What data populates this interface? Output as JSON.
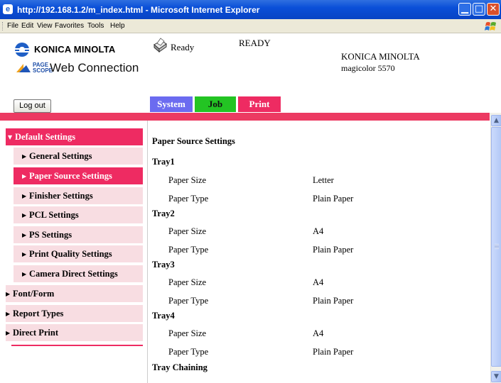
{
  "window": {
    "title": "http://192.168.1.2/m_index.html - Microsoft Internet Explorer"
  },
  "menu": [
    "File",
    "Edit",
    "View",
    "Favorites",
    "Tools",
    "Help"
  ],
  "header": {
    "brand_logo_text": "KONICA MINOLTA",
    "pagescope_mark": [
      "PAGE",
      "SCOPE"
    ],
    "web_connection": "Web Connection",
    "status_icon_label": "Ready",
    "status_upper": "READY",
    "brand_name": "KONICA MINOLTA",
    "model": "magicolor 5570"
  },
  "logout_label": "Log out",
  "tabs": [
    "System",
    "Job",
    "Print"
  ],
  "sidebar": {
    "default_settings": "Default Settings",
    "sub": [
      "General Settings",
      "Paper Source Settings",
      "Finisher Settings",
      "PCL Settings",
      "PS Settings",
      "Print Quality Settings",
      "Camera Direct Settings"
    ],
    "top": [
      "Font/Form",
      "Report Types",
      "Direct Print"
    ]
  },
  "content": {
    "title": "Paper Source Settings",
    "trays": [
      {
        "name": "Tray1",
        "rows": [
          {
            "label": "Paper Size",
            "value": "Letter"
          },
          {
            "label": "Paper Type",
            "value": "Plain Paper"
          }
        ]
      },
      {
        "name": "Tray2",
        "rows": [
          {
            "label": "Paper Size",
            "value": "A4"
          },
          {
            "label": "Paper Type",
            "value": "Plain Paper"
          }
        ]
      },
      {
        "name": "Tray3",
        "rows": [
          {
            "label": "Paper Size",
            "value": "A4"
          },
          {
            "label": "Paper Type",
            "value": "Plain Paper"
          }
        ]
      },
      {
        "name": "Tray4",
        "rows": [
          {
            "label": "Paper Size",
            "value": "A4"
          },
          {
            "label": "Paper Type",
            "value": "Plain Paper"
          }
        ]
      }
    ],
    "tray_chaining": "Tray Chaining"
  },
  "colors": {
    "accent_pink": "#ee2b62",
    "tab_system": "#6b6bf0",
    "tab_job": "#23c423",
    "tab_print": "#ee2b62"
  }
}
